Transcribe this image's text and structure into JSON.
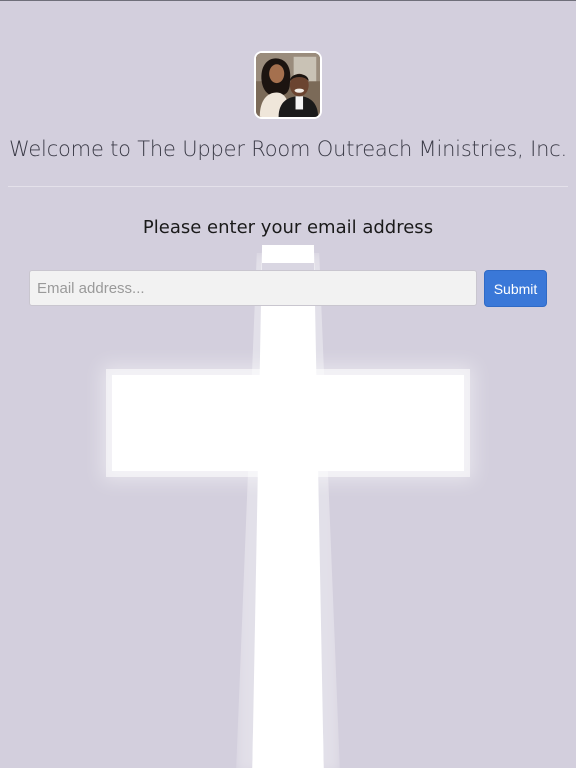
{
  "header": {
    "avatar_icon": "couple-photo",
    "title": "Welcome to The Upper Room Outreach Ministries, Inc."
  },
  "form": {
    "prompt": "Please enter your email address",
    "email_placeholder": "Email address...",
    "email_value": "",
    "submit_label": "Submit"
  },
  "background": {
    "icon": "cross-icon"
  },
  "colors": {
    "background": "#d3cfdd",
    "accent": "#3a78d8",
    "input_background": "#f2f2f2"
  }
}
